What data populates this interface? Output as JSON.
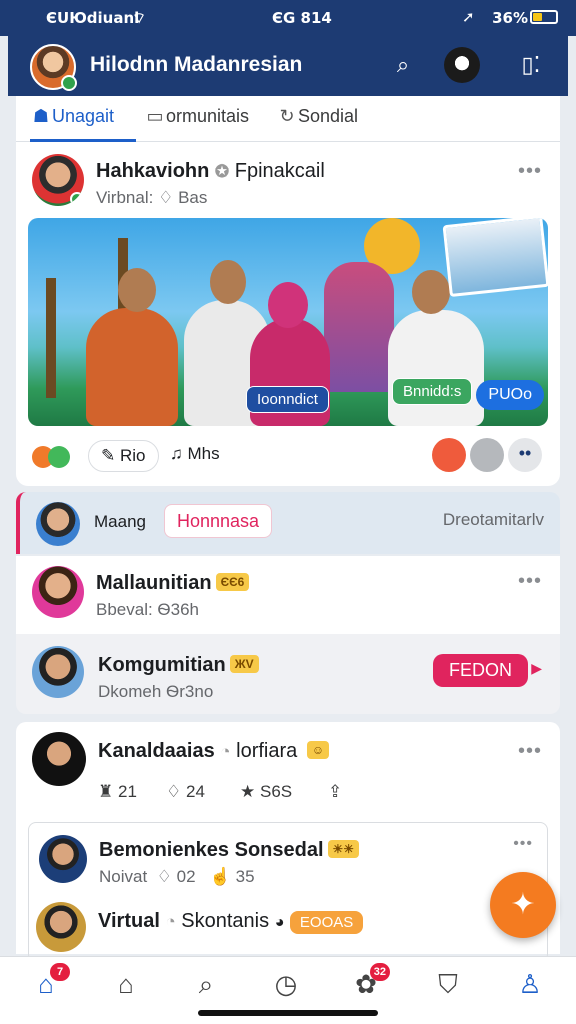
{
  "status_bar": {
    "carrier": "ЄUЮdiuanl",
    "time": "ЄG 814",
    "battery": "36%",
    "battery_level": 0.36
  },
  "header": {
    "title": "Hilodnn Madanresian",
    "search_icon": "search-icon",
    "menu_icon": "grid-icon"
  },
  "tabs": [
    {
      "label": "Unagait",
      "icon": "people-icon",
      "active": true
    },
    {
      "label": "ormunitais",
      "icon": "chat-icon",
      "active": false
    },
    {
      "label": "Sondial",
      "icon": "refresh-icon",
      "active": false
    }
  ],
  "post1": {
    "author": "Hahkaviohn",
    "badge_text": "Fpinakcail",
    "subtitle_label": "Virbnal:",
    "subtitle_value": "Bas",
    "image_tags": [
      "Ioonndict",
      "Bnnidd:s",
      "PUOo"
    ],
    "actions": {
      "share_label": "Rio",
      "music_label": "Mhs"
    }
  },
  "strip": {
    "name": "Maang",
    "badge": "Honnnasa",
    "right_text": "Dreotamitarlv"
  },
  "row1": {
    "name": "Mallaunitian",
    "emoji_badge": "ЄЄ6",
    "subtitle": "Bbeval: Ѳ36h"
  },
  "row2": {
    "name": "Komgumitian",
    "emoji_badge": "ЖV",
    "subtitle": "Dkomeh Ѳr3no",
    "follow_label": "FEDON"
  },
  "post3": {
    "author": "Kanaldaaias",
    "author_extra": "lorfiara",
    "stats": {
      "comments": "21",
      "likes": "24",
      "shares": "S6S"
    },
    "inner": {
      "name": "Bemonienkes Sonsedal",
      "sub_label": "Noivat",
      "likes": "02",
      "thumbs": "35"
    },
    "bottom": {
      "name": "Virtual",
      "extra": "Skontanis",
      "tag": "EOOAS"
    }
  },
  "nav": {
    "home_badge": "7",
    "alerts_badge": "32"
  }
}
